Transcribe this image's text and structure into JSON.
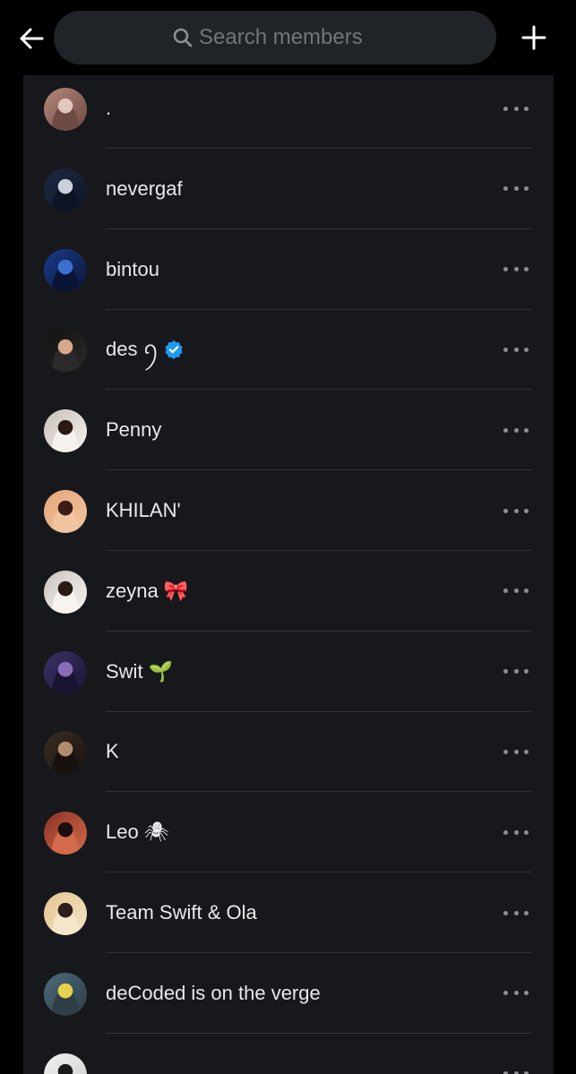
{
  "header": {
    "search_placeholder": "Search members"
  },
  "members": [
    {
      "name": ".",
      "emoji": "",
      "verified": false,
      "avatar_colors": [
        "#b3877a",
        "#e3c7be",
        "#6d4a42"
      ]
    },
    {
      "name": "nevergaf",
      "emoji": "",
      "verified": false,
      "avatar_colors": [
        "#1e2a44",
        "#c9cfdb",
        "#0d1424"
      ]
    },
    {
      "name": "bintou",
      "emoji": "",
      "verified": false,
      "avatar_colors": [
        "#1b3c8f",
        "#3d6fd1",
        "#0a1433"
      ]
    },
    {
      "name": "des",
      "emoji": "ꪆ",
      "verified": true,
      "avatar_colors": [
        "#111111",
        "#d7a98b",
        "#2a2a2a"
      ]
    },
    {
      "name": "Penny",
      "emoji": "",
      "verified": false,
      "avatar_colors": [
        "#c9c1bb",
        "#2b1a14",
        "#f4f1ee"
      ]
    },
    {
      "name": "KHILAN'",
      "emoji": "",
      "verified": false,
      "avatar_colors": [
        "#e6a77b",
        "#3a1e14",
        "#f1c49f"
      ]
    },
    {
      "name": "zeyna",
      "emoji": "🎀",
      "verified": false,
      "avatar_colors": [
        "#cbc5c0",
        "#2b1a14",
        "#f6f3f1"
      ]
    },
    {
      "name": "Swit",
      "emoji": "🌱",
      "verified": false,
      "avatar_colors": [
        "#3b3266",
        "#8a6db8",
        "#1a1433"
      ]
    },
    {
      "name": "K",
      "emoji": "",
      "verified": false,
      "avatar_colors": [
        "#3a2d22",
        "#b18d6f",
        "#171210"
      ]
    },
    {
      "name": "Leo",
      "emoji": "🕷",
      "verified": false,
      "avatar_colors": [
        "#8a3327",
        "#1a0f0c",
        "#d36a4b"
      ]
    },
    {
      "name": "Team Swift & Ola",
      "emoji": "",
      "verified": false,
      "avatar_colors": [
        "#e3c48f",
        "#2d1f1a",
        "#f6e6c9"
      ]
    },
    {
      "name": "deCoded is on the verge",
      "emoji": "",
      "verified": false,
      "avatar_colors": [
        "#4d6a7a",
        "#e8d14c",
        "#2d3e47"
      ]
    },
    {
      "name": "",
      "emoji": "",
      "verified": false,
      "avatar_colors": [
        "#f1f1f1",
        "#1b1b1b",
        "#cfcfcf"
      ]
    }
  ],
  "colors": {
    "background": "#000000",
    "panel": "#17181c",
    "divider": "#2f3336",
    "text": "#e7e9ea",
    "muted": "#71767b",
    "verified": "#1d9bf0"
  }
}
